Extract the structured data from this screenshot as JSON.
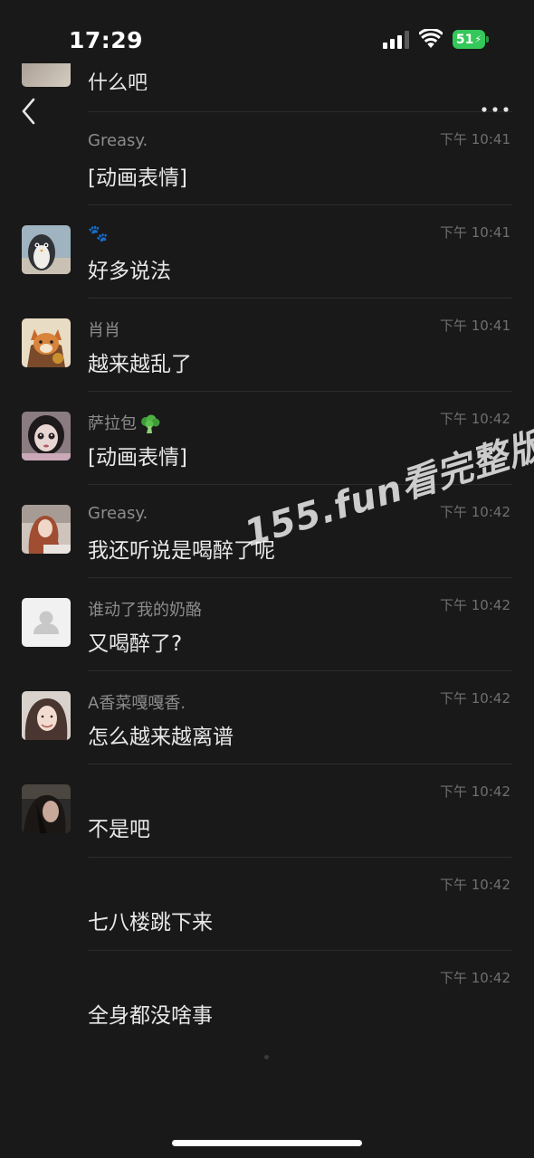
{
  "status_bar": {
    "time": "17:29",
    "battery": "51"
  },
  "partial_row": {
    "text": "什么吧"
  },
  "messages": [
    {
      "name": "Greasy.",
      "time": "下午 10:41",
      "content": "[动画表情]",
      "avatar": "none"
    },
    {
      "name": "🐾",
      "time": "下午 10:41",
      "content": "好多说法",
      "avatar": "penguin"
    },
    {
      "name": "肖肖",
      "time": "下午 10:41",
      "content": "越来越乱了",
      "avatar": "cartoon-fox"
    },
    {
      "name": "萨拉包",
      "name_emoji": "broccoli",
      "time": "下午 10:42",
      "content": "[动画表情]",
      "avatar": "doll"
    },
    {
      "name": "Greasy.",
      "time": "下午 10:42",
      "content": "我还听说是喝醉了呢",
      "avatar": "girl-red-hair"
    },
    {
      "name": "谁动了我的奶酪",
      "time": "下午 10:42",
      "content": "又喝醉了?",
      "avatar": "default"
    },
    {
      "name": "A香菜嘎嘎香.",
      "time": "下午 10:42",
      "content": "怎么越来越离谱",
      "avatar": "girl-smile"
    },
    {
      "name": "",
      "time": "下午 10:42",
      "content": "不是吧",
      "avatar": "girl-dark"
    },
    {
      "name": "",
      "time": "下午 10:42",
      "content": "七八楼跳下来",
      "avatar": "none"
    },
    {
      "name": "",
      "time": "下午 10:42",
      "content": "全身都没啥事",
      "avatar": "none"
    }
  ],
  "watermark": "155.fun看完整版",
  "colors": {
    "background": "#191919",
    "battery": "#34c759"
  }
}
